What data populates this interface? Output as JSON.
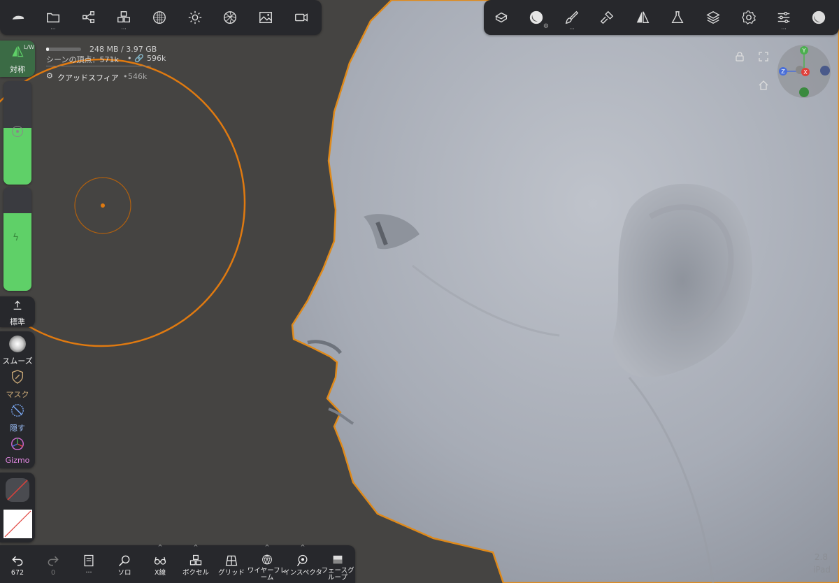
{
  "viewport": {
    "memory": "248 MB / 3.97 GB",
    "scene_vertices_label": "シーンの頂点：571k",
    "scene_link": "596k",
    "object_name": "クアッドスフィア",
    "object_count": "546k",
    "zoom": "2.8",
    "device": "iPad"
  },
  "top_left_toolbar": {
    "items": [
      "logo-icon",
      "folder-icon",
      "scene-graph-icon",
      "primitives-icon",
      "sculpt-icon",
      "light-icon",
      "shading-icon",
      "image-icon",
      "camera-icon"
    ]
  },
  "top_right_toolbar": {
    "items": [
      "scene-icon",
      "material-icon",
      "brush-icon",
      "tool-icon",
      "symmetry-icon",
      "flask-icon",
      "layers-icon",
      "settings-icon",
      "sliders-icon",
      "matcap-icon"
    ]
  },
  "sidebar": {
    "symmetry_label": "対称",
    "symmetry_badge": "L/W",
    "radius_fill": 0.55,
    "intensity_fill": 0.75,
    "standard_label": "標準",
    "smooth_label": "スムーズ",
    "mask_label": "マスク",
    "hide_label": "隠す",
    "gizmo_label": "Gizmo"
  },
  "bottom_toolbar": {
    "undo_count": "672",
    "redo_count": "0",
    "items": [
      {
        "name": "undo-button",
        "label": "672"
      },
      {
        "name": "redo-button",
        "label": "0"
      },
      {
        "name": "book-button",
        "label": "···"
      },
      {
        "name": "solo-button",
        "label": "ソロ"
      },
      {
        "name": "xray-button",
        "label": "X線"
      },
      {
        "name": "voxel-button",
        "label": "ボクセル"
      },
      {
        "name": "grid-button",
        "label": "グリッド"
      },
      {
        "name": "wireframe-button",
        "label": "ワイヤーフレーム"
      },
      {
        "name": "inspector-button",
        "label": "インスペクタ"
      },
      {
        "name": "facegroup-button",
        "label": "フェースグループ"
      }
    ]
  },
  "colors": {
    "accent_green": "#5fd068",
    "brush_orange": "#e07a10",
    "gizmo_x": "#e0403a",
    "gizmo_y": "#4caf50",
    "gizmo_z": "#4a6fd8"
  }
}
